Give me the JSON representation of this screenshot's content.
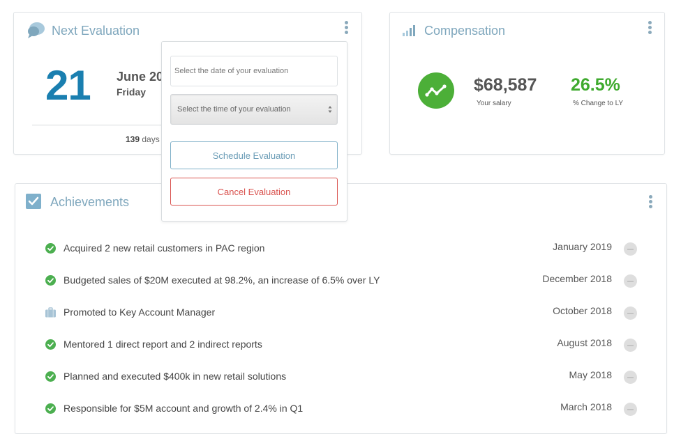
{
  "next_evaluation": {
    "title": "Next Evaluation",
    "icon": "chat-bubbles-icon",
    "day": "21",
    "month_year": "June 20",
    "weekday": "Friday",
    "days_count": "139",
    "days_suffix": " days"
  },
  "evaluation_popover": {
    "date_placeholder": "Select the date of your evaluation",
    "time_placeholder": "Select the time of your evaluation",
    "schedule_label": "Schedule Evaluation",
    "cancel_label": "Cancel Evaluation"
  },
  "compensation": {
    "title": "Compensation",
    "icon": "bar-signal-icon",
    "salary_value": "$68,587",
    "salary_label": "Your salary",
    "change_value": "26.5%",
    "change_label": "% Change to LY",
    "accent_color": "#4caf38"
  },
  "achievements": {
    "title": "Achievements",
    "icon": "checkbox-icon",
    "items": [
      {
        "text": "Acquired 2 new retail customers in PAC region",
        "date": "January 2019",
        "icon": "check-circle-icon"
      },
      {
        "text": "Budgeted sales of $20M executed at 98.2%, an increase of 6.5% over LY",
        "date": "December 2018",
        "icon": "check-circle-icon"
      },
      {
        "text": "Promoted to Key Account Manager",
        "date": "October 2018",
        "icon": "briefcase-icon"
      },
      {
        "text": "Mentored 1 direct report and 2 indirect reports",
        "date": "August 2018",
        "icon": "check-circle-icon"
      },
      {
        "text": "Planned and executed $400k in new retail solutions",
        "date": "May 2018",
        "icon": "check-circle-icon"
      },
      {
        "text": "Responsible for $5M account and growth of 2.4% in Q1",
        "date": "March 2018",
        "icon": "check-circle-icon"
      }
    ]
  },
  "colors": {
    "title_blue": "#7fa7bd",
    "day_blue": "#1a7fb0",
    "success_green": "#4caf38",
    "danger_red": "#d9534f"
  }
}
